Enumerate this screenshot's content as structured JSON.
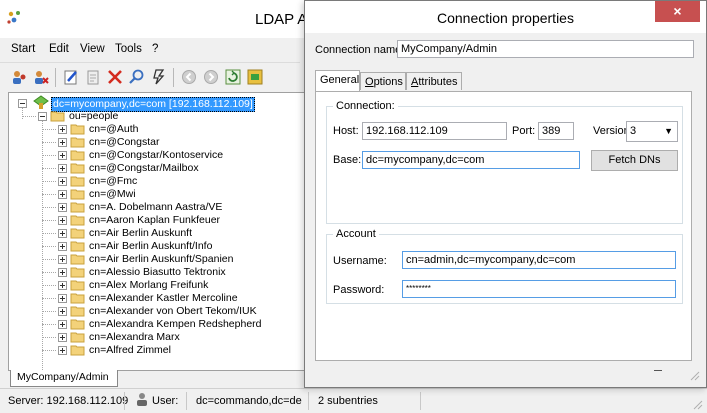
{
  "main_window": {
    "title": "LDAP Ac",
    "menu": [
      "Start",
      "Edit",
      "View",
      "Tools",
      "?"
    ],
    "toolbar_icons": [
      "users-icon",
      "user-remove-icon",
      "edit-icon",
      "properties-icon",
      "delete-icon",
      "search-icon",
      "filter-icon",
      "back-icon",
      "forward-icon",
      "refresh-icon",
      "export-icon"
    ]
  },
  "tree": {
    "root": "dc=mycompany,dc=com [192.168.112.109]",
    "child": "ou=people",
    "items": [
      "cn=@Auth",
      "cn=@Congstar",
      "cn=@Congstar/Kontoservice",
      "cn=@Congstar/Mailbox",
      "cn=@Fmc",
      "cn=@Mwi",
      "cn=A. Dobelmann Aastra/VE",
      "cn=Aaron Kaplan Funkfeuer",
      "cn=Air Berlin Auskunft",
      "cn=Air Berlin Auskunft/Info",
      "cn=Air Berlin Auskunft/Spanien",
      "cn=Alessio Biasutto Tektronix",
      "cn=Alex Morlang Freifunk",
      "cn=Alexander Kastler Mercoline",
      "cn=Alexander von Obert Tekom/IUK",
      "cn=Alexandra Kempen Redshepherd",
      "cn=Alexandra Marx",
      "cn=Alfred Zimmel"
    ]
  },
  "doc_tab": "MyCompany/Admin",
  "status": {
    "server": "Server: 192.168.112.109",
    "user_label": "User:",
    "user_value": "dc=commando,dc=de",
    "subentries": "2 subentries"
  },
  "dialog": {
    "title": "Connection properties",
    "close": "×",
    "connection_name_label": "Connection name:",
    "connection_name_value": "MyCompany/Admin",
    "tabs": [
      {
        "label": "General",
        "underline": ""
      },
      {
        "pre": "",
        "underline": "O",
        "post": "ptions"
      },
      {
        "pre": "",
        "underline": "A",
        "post": "ttributes"
      }
    ],
    "connection_group": "Connection:",
    "host_label": "Host:",
    "host_value": "192.168.112.109",
    "port_label": "Port:",
    "port_value": "389",
    "version_label": "Version:",
    "version_value": "3",
    "base_label": "Base:",
    "base_value": "dc=mycompany,dc=com",
    "fetch_button": "Fetch DNs",
    "account_group": "Account",
    "username_label": "Username:",
    "username_value": "cn=admin,dc=mycompany,dc=com",
    "password_label": "Password:",
    "password_value": "********"
  }
}
